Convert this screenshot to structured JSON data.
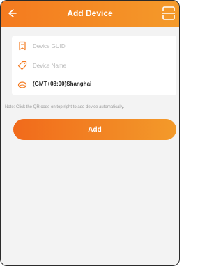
{
  "header": {
    "title": "Add Device"
  },
  "form": {
    "guid_placeholder": "Device GUID",
    "name_placeholder": "Device Name",
    "timezone_value": "(GMT+08:00)Shanghai"
  },
  "note": "Note: Click the QR code on top right to add device automatically.",
  "add_button_label": "Add",
  "colors": {
    "accent": "#f47a1f",
    "accent_light": "#f49a2a",
    "background": "#f3f3f3"
  },
  "icons": {
    "back": "arrow-left-icon",
    "scan": "qr-scan-icon",
    "guid": "bookmark-icon",
    "name": "tag-icon",
    "timezone": "globe-icon"
  }
}
